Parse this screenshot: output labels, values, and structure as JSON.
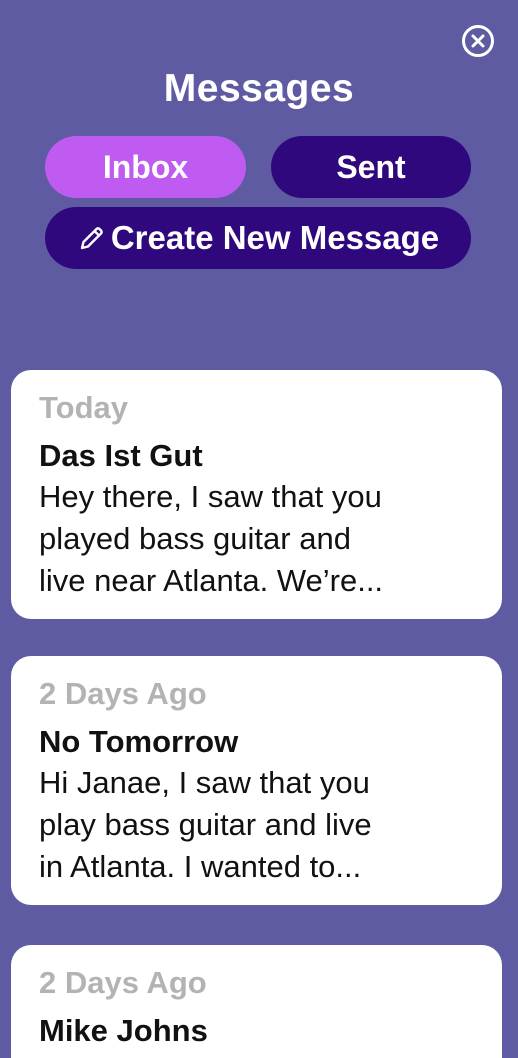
{
  "header": {
    "title": "Messages",
    "close_icon": "close-circle-icon"
  },
  "tabs": [
    {
      "label": "Inbox",
      "active": true,
      "color": "#c05bf2"
    },
    {
      "label": "Sent",
      "active": false,
      "color": "#30087e"
    }
  ],
  "create_button": {
    "label": "Create New Message",
    "icon": "pencil-icon"
  },
  "colors": {
    "background": "#5e5ba2",
    "accent": "#c05bf2",
    "dark_button": "#30087e",
    "card": "#ffffff",
    "date_text": "#b3b3b3"
  },
  "messages": [
    {
      "date": "Today",
      "sender": "Das Ist Gut",
      "preview_lines": [
        "Hey there, I saw that you",
        "played bass guitar and",
        "live near Atlanta. We’re..."
      ]
    },
    {
      "date": "2 Days Ago",
      "sender": "No Tomorrow",
      "preview_lines": [
        "Hi Janae, I saw that you",
        "play bass guitar and live",
        "in Atlanta. I wanted to..."
      ]
    },
    {
      "date": "2 Days Ago",
      "sender": "Mike Johns",
      "preview_lines": []
    }
  ]
}
